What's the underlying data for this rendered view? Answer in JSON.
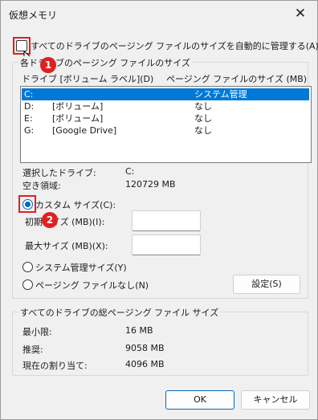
{
  "window": {
    "title": "仮想メモリ",
    "close_glyph": "✕"
  },
  "auto_manage": {
    "label": "すべてのドライブのページング ファイルのサイズを自動的に管理する(A)",
    "checked": false
  },
  "per_drive": {
    "group_title": "各ドライブのページング ファイルのサイズ",
    "col_drive": "ドライブ [ボリューム ラベル](D)",
    "col_size": "ページング ファイルのサイズ (MB)",
    "drives": [
      {
        "letter": "C:",
        "label": "",
        "size": "システム管理",
        "selected": true
      },
      {
        "letter": "D:",
        "label": "[ボリューム]",
        "size": "なし",
        "selected": false
      },
      {
        "letter": "E:",
        "label": "[ボリューム]",
        "size": "なし",
        "selected": false
      },
      {
        "letter": "G:",
        "label": "[Google Drive]",
        "size": "なし",
        "selected": false
      }
    ],
    "selected_drive_label": "選択したドライブ:",
    "selected_drive_value": "C:",
    "free_space_label": "空き領域:",
    "free_space_value": "120729 MB",
    "custom_size": {
      "label": "カスタム サイズ(C):",
      "selected": true
    },
    "initial_size": {
      "label": "初期サイズ (MB)(I):",
      "value": ""
    },
    "max_size": {
      "label": "最大サイズ (MB)(X):",
      "value": ""
    },
    "system_managed": {
      "label": "システム管理サイズ(Y)",
      "selected": false
    },
    "no_paging": {
      "label": "ページング ファイルなし(N)",
      "selected": false
    },
    "set_button": "設定(S)"
  },
  "total": {
    "group_title": "すべてのドライブの総ページング ファイル サイズ",
    "min_label": "最小限:",
    "min_value": "16 MB",
    "recommended_label": "推奨:",
    "recommended_value": "9058 MB",
    "current_label": "現在の割り当て:",
    "current_value": "4096 MB"
  },
  "buttons": {
    "ok": "OK",
    "cancel": "キャンセル"
  },
  "annotations": {
    "badge1": "1",
    "badge2": "2",
    "color": "#e02020"
  }
}
